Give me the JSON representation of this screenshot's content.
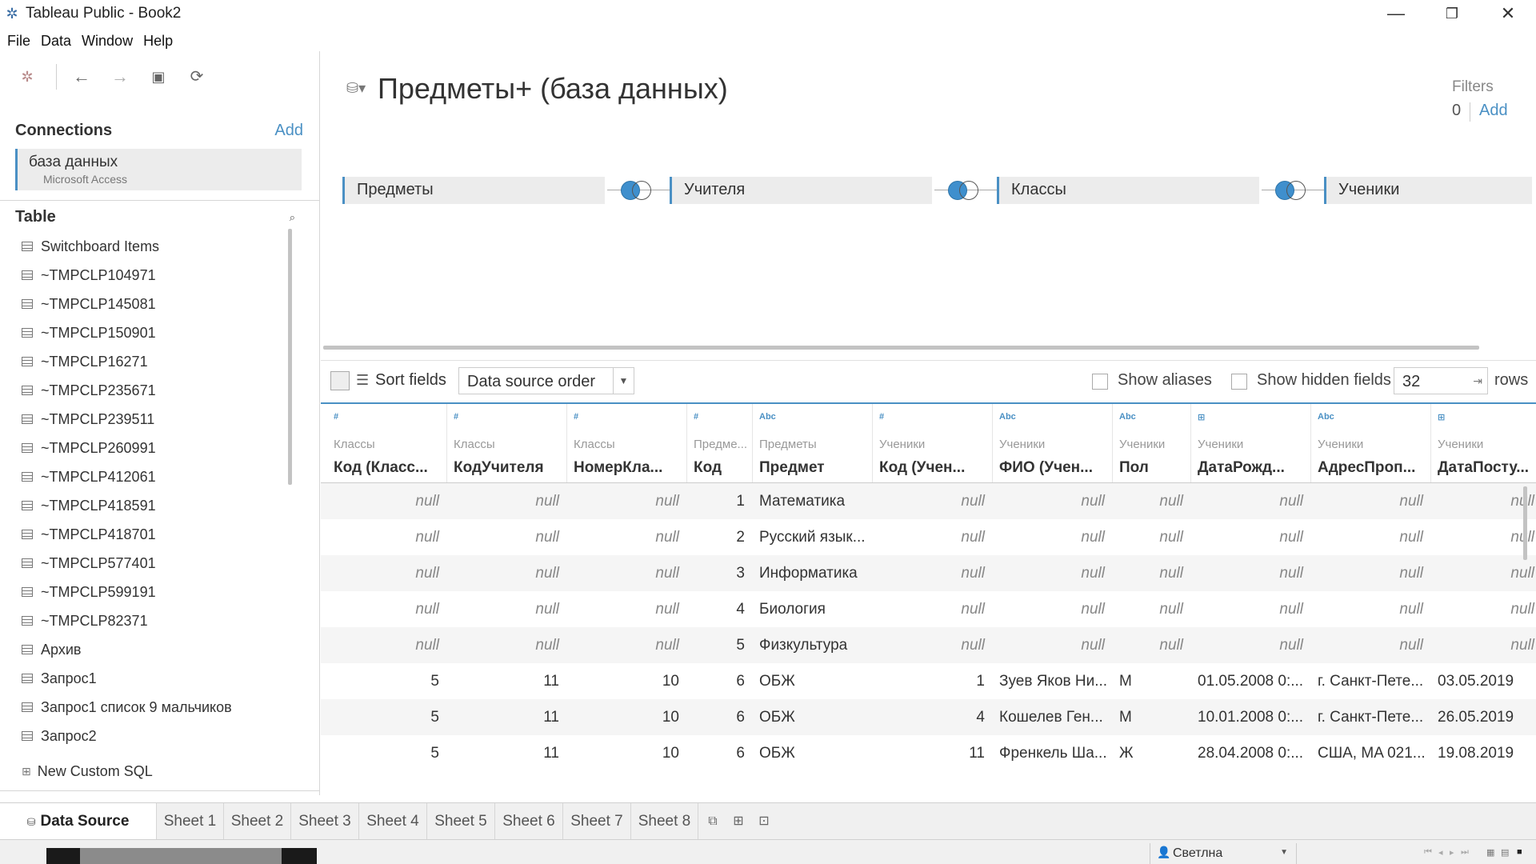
{
  "window": {
    "title": "Tableau Public - Book2",
    "minimize": "—",
    "restore": "❐",
    "close": "✕"
  },
  "menu": [
    "File",
    "Data",
    "Window",
    "Help"
  ],
  "connections": {
    "heading": "Connections",
    "add_label": "Add",
    "item": {
      "name": "база данных",
      "type": "Microsoft Access"
    }
  },
  "tables": {
    "heading": "Table",
    "items": [
      "Switchboard Items",
      "~TMPCLP104971",
      "~TMPCLP145081",
      "~TMPCLP150901",
      "~TMPCLP16271",
      "~TMPCLP235671",
      "~TMPCLP239511",
      "~TMPCLP260991",
      "~TMPCLP412061",
      "~TMPCLP418591",
      "~TMPCLP418701",
      "~TMPCLP577401",
      "~TMPCLP599191",
      "~TMPCLP82371",
      "Архив",
      "Запрос1",
      "Запрос1 список 9 мальчиков",
      "Запрос2"
    ],
    "custom_sql": "New Custom SQL"
  },
  "datasource": {
    "title": "Предметы+ (база данных)",
    "filters_label": "Filters",
    "filters_count": "0",
    "filters_add": "Add",
    "joined_tables": [
      "Предметы",
      "Учителя",
      "Классы",
      "Ученики"
    ]
  },
  "gridbar": {
    "sort_label": "Sort fields",
    "sort_value": "Data source order",
    "show_aliases": "Show aliases",
    "show_hidden": "Show hidden fields",
    "rows_value": "32",
    "rows_label": "rows"
  },
  "grid": {
    "columns": [
      {
        "type": "#",
        "source": "Классы",
        "name": "Код (Класс..."
      },
      {
        "type": "#",
        "source": "Классы",
        "name": "КодУчителя"
      },
      {
        "type": "#",
        "source": "Классы",
        "name": "НомерКла..."
      },
      {
        "type": "#",
        "source": "Предме...",
        "name": "Код"
      },
      {
        "type": "Abc",
        "source": "Предметы",
        "name": "Предмет"
      },
      {
        "type": "#",
        "source": "Ученики",
        "name": "Код (Учен..."
      },
      {
        "type": "Abc",
        "source": "Ученики",
        "name": "ФИО (Учен..."
      },
      {
        "type": "Abc",
        "source": "Ученики",
        "name": "Пол"
      },
      {
        "type": "⊞",
        "source": "Ученики",
        "name": "ДатаРожд..."
      },
      {
        "type": "Abc",
        "source": "Ученики",
        "name": "АдресПроп..."
      },
      {
        "type": "⊞",
        "source": "Ученики",
        "name": "ДатаПосту..."
      }
    ],
    "rows": [
      [
        "null",
        "null",
        "null",
        "1",
        "Математика",
        "null",
        "null",
        "null",
        "null",
        "null",
        "null"
      ],
      [
        "null",
        "null",
        "null",
        "2",
        "Русский язык...",
        "null",
        "null",
        "null",
        "null",
        "null",
        "null"
      ],
      [
        "null",
        "null",
        "null",
        "3",
        "Информатика",
        "null",
        "null",
        "null",
        "null",
        "null",
        "null"
      ],
      [
        "null",
        "null",
        "null",
        "4",
        "Биология",
        "null",
        "null",
        "null",
        "null",
        "null",
        "null"
      ],
      [
        "null",
        "null",
        "null",
        "5",
        "Физкультура",
        "null",
        "null",
        "null",
        "null",
        "null",
        "null"
      ],
      [
        "5",
        "11",
        "10",
        "6",
        "ОБЖ",
        "1",
        "Зуев Яков Ни...",
        "М",
        "01.05.2008 0:...",
        "г. Санкт-Пете...",
        "03.05.2019"
      ],
      [
        "5",
        "11",
        "10",
        "6",
        "ОБЖ",
        "4",
        "Кошелев Ген...",
        "М",
        "10.01.2008 0:...",
        "г. Санкт-Пете...",
        "26.05.2019"
      ],
      [
        "5",
        "11",
        "10",
        "6",
        "ОБЖ",
        "11",
        "Френкель Ша...",
        "Ж",
        "28.04.2008 0:...",
        "США, MA 021...",
        "19.08.2019"
      ]
    ]
  },
  "tabs": {
    "datasource": "Data Source",
    "sheets": [
      "Sheet 1",
      "Sheet 2",
      "Sheet 3",
      "Sheet 4",
      "Sheet 5",
      "Sheet 6",
      "Sheet 7",
      "Sheet 8"
    ]
  },
  "status": {
    "user": "Светлна"
  },
  "colors": {
    "accent": "#4a90c4",
    "join_fill": "#3f8fcd"
  }
}
